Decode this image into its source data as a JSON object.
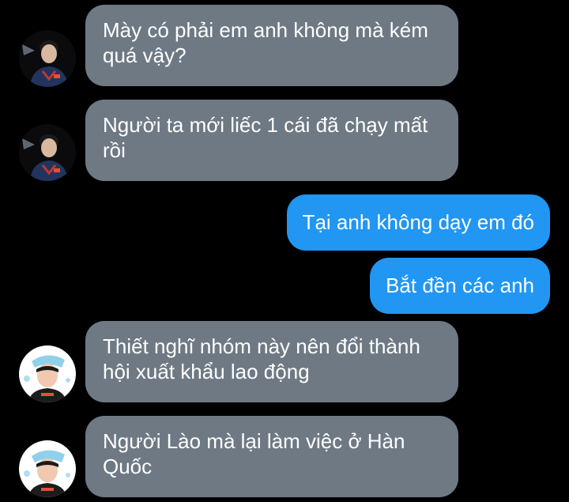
{
  "conversation": {
    "messages": [
      {
        "direction": "incoming",
        "sender_avatar": "player-avatar-dark",
        "text": "Mày có phải em anh không mà kém quá vậy?"
      },
      {
        "direction": "incoming",
        "sender_avatar": "player-avatar-dark",
        "text": "Người ta mới liếc 1 cái đã chạy mất rồi"
      },
      {
        "direction": "outgoing",
        "text": "Tại anh không dạy em đó"
      },
      {
        "direction": "outgoing",
        "text": "Bắt đền các anh"
      },
      {
        "direction": "incoming",
        "sender_avatar": "player-avatar-light",
        "text": "Thiết nghĩ nhóm này nên đổi thành hội xuất khẩu lao động"
      },
      {
        "direction": "incoming",
        "sender_avatar": "player-avatar-light",
        "text": "Người Lào mà lại làm việc ở Hàn Quốc"
      }
    ]
  },
  "colors": {
    "background": "#000000",
    "incoming_bubble": "#6e7984",
    "outgoing_bubble": "#2196f3",
    "text": "#ffffff"
  }
}
